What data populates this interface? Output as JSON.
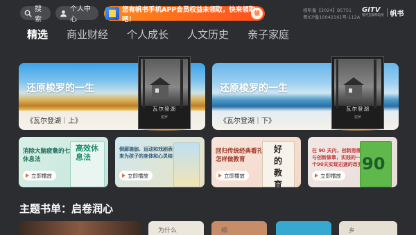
{
  "topbar": {
    "search_label": "搜索",
    "user_label": "个人中心",
    "promo_text": "您有帆书手机APP会员权益未领取，快来领取吧！",
    "promo_button": "领",
    "license_line1": "视听备【2024】B5751",
    "license_line2": "粤ICP备10042161号-112A",
    "brand_logo": "GITV",
    "brand_logo_sub": "银河互联网电视",
    "brand_name": "帆书"
  },
  "tabs": [
    {
      "label": "精选",
      "active": true
    },
    {
      "label": "商业财经",
      "active": false
    },
    {
      "label": "个人成长",
      "active": false
    },
    {
      "label": "人文历史",
      "active": false
    },
    {
      "label": "亲子家庭",
      "active": false
    }
  ],
  "heroes": [
    {
      "title": "还原梭罗的一生",
      "subtitle": "《瓦尔登湖｜上》",
      "cover_title": "瓦尔登湖",
      "cover_author": "梭罗"
    },
    {
      "title": "还原梭罗的一生",
      "subtitle": "《瓦尔登湖｜下》",
      "cover_title": "瓦尔登湖",
      "cover_author": "梭罗"
    }
  ],
  "cards": [
    {
      "title": "消除大脑疲惫的七个休息法",
      "play_label": "立即播放",
      "book_text": "高效休息法"
    },
    {
      "title": "倒廊瑜伽、运动和戏剧表演的方法来为孩子的身体和心灵结合在一起",
      "play_label": "立即播放",
      "book_text": ""
    },
    {
      "title": "回归传统经典看孔子怎样做教育",
      "play_label": "立即播放",
      "book_text": "好的教育"
    },
    {
      "title": "在 90 天内，创新思维与创新做事，实践的一个90天实现迅速的改变",
      "play_label": "立即播放",
      "book_text": "90"
    }
  ],
  "section": {
    "title": "主题书单：启卷润心"
  },
  "strip_items": [
    {
      "text": ""
    },
    {
      "text": "为什么"
    },
    {
      "text": "细"
    },
    {
      "text": ""
    },
    {
      "text": "乡"
    }
  ],
  "colors": {
    "background": "#2c2d30",
    "accent": "#ff6a1e"
  }
}
